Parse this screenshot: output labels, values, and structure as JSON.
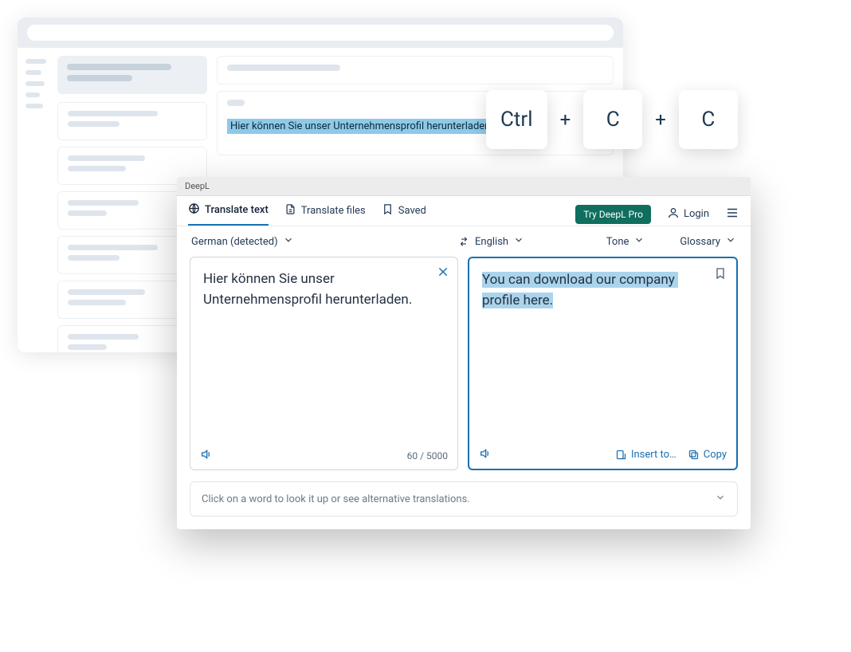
{
  "background": {
    "highlighted_text": "Hier können Sie unser Unternehmensprofil herunterladen"
  },
  "shortcut": {
    "key1": "Ctrl",
    "plus1": "+",
    "key2": "C",
    "plus2": "+",
    "key3": "C"
  },
  "deepl": {
    "title": "DeepL",
    "tabs": {
      "translate_text": "Translate text",
      "translate_files": "Translate files",
      "saved": "Saved"
    },
    "header": {
      "try_pro": "Try DeepL Pro",
      "login": "Login"
    },
    "lang": {
      "source": "German (detected)",
      "target": "English",
      "tone": "Tone",
      "glossary": "Glossary"
    },
    "source_text": "Hier können Sie unser Unternehmensprofil herunterladen.",
    "target_text": "You can download our company profile here.",
    "char_count": "60 / 5000",
    "actions": {
      "insert": "Insert to…",
      "copy": "Copy"
    },
    "hint": "Click on a word to look it up or see alternative translations."
  }
}
